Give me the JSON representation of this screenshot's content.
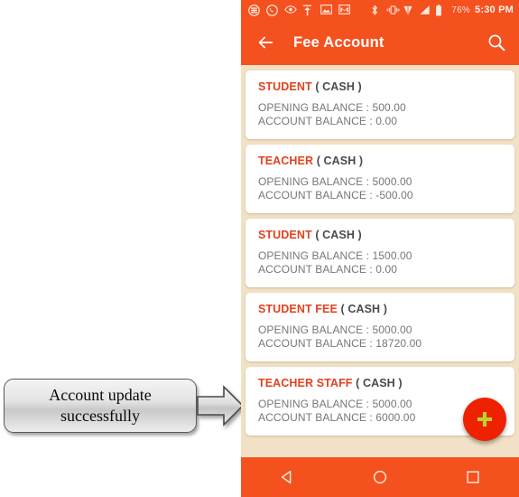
{
  "statusbar": {
    "icons": [
      "apps-icon",
      "whatsapp-icon",
      "eye-icon",
      "upload-icon",
      "image-icon",
      "gmail-icon",
      "bluetooth-icon",
      "vibrate-icon",
      "location-icon",
      "signal-icon",
      "battery-icon"
    ],
    "battery_percent": "76%",
    "time": "5:30 PM"
  },
  "appbar": {
    "back_icon": "back-arrow-icon",
    "title": "Fee Account",
    "search_icon": "search-icon"
  },
  "accounts": [
    {
      "name": "STUDENT",
      "type": "( CASH )",
      "opening_balance": "OPENING BALANCE : 500.00",
      "account_balance": "ACCOUNT BALANCE : 0.00"
    },
    {
      "name": "TEACHER",
      "type": "( CASH )",
      "opening_balance": "OPENING BALANCE : 5000.00",
      "account_balance": "ACCOUNT BALANCE : -500.00"
    },
    {
      "name": "STUDENT",
      "type": "( CASH )",
      "opening_balance": "OPENING BALANCE : 1500.00",
      "account_balance": "ACCOUNT BALANCE : 0.00"
    },
    {
      "name": "STUDENT FEE",
      "type": "( CASH )",
      "opening_balance": "OPENING BALANCE : 5000.00",
      "account_balance": "ACCOUNT BALANCE : 18720.00"
    },
    {
      "name": "TEACHER STAFF",
      "type": "( CASH )",
      "opening_balance": "OPENING BALANCE : 5000.00",
      "account_balance": "ACCOUNT BALANCE : 6000.00"
    }
  ],
  "fab": {
    "icon": "plus-icon",
    "label": "+"
  },
  "navbar": {
    "back": "nav-back-icon",
    "home": "nav-home-icon",
    "recents": "nav-recents-icon"
  },
  "annotation": {
    "line1": "Account update",
    "line2": "successfully",
    "arrow_icon": "right-arrow-icon"
  },
  "colors": {
    "primary": "#f4511e",
    "page_background": "#f2e1c6",
    "card": "#ffffff",
    "account_name": "#e2421f",
    "body_text": "#777777",
    "fab": "#ee2200",
    "fab_plus": "#b7d62a"
  }
}
